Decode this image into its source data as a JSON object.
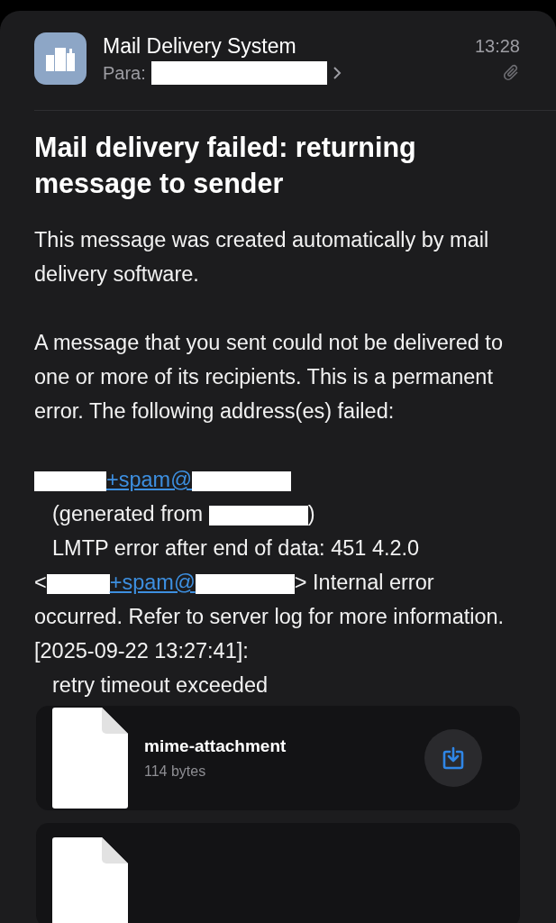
{
  "header": {
    "sender": "Mail Delivery System",
    "to_label": "Para:",
    "to_redacted": true,
    "time": "13:28",
    "has_attachment": true
  },
  "subject": "Mail delivery failed: returning message to sender",
  "paragraphs": [
    "This message was created automatically by mail delivery software.",
    "A message that you sent could not be delivered to one or more of its recipients. This is a permanent error. The following address(es) failed:"
  ],
  "error_lines": [
    {
      "indent": false,
      "parts": [
        {
          "kind": "redacted"
        },
        {
          "kind": "link",
          "text": "+spam@"
        },
        {
          "kind": "redacted"
        }
      ]
    },
    {
      "indent": true,
      "parts": [
        {
          "kind": "text",
          "text": "(generated from "
        },
        {
          "kind": "redacted"
        },
        {
          "kind": "text",
          "text": ")"
        }
      ]
    },
    {
      "indent": true,
      "parts": [
        {
          "kind": "text",
          "text": "LMTP error after end of data: 451 4.2.0"
        }
      ]
    },
    {
      "indent": false,
      "parts": [
        {
          "kind": "text",
          "text": "<"
        },
        {
          "kind": "redacted"
        },
        {
          "kind": "link",
          "text": "+spam@"
        },
        {
          "kind": "redacted"
        },
        {
          "kind": "text",
          "text": "> Internal error occurred. Refer to server log for more information. [2025-09-22 13:27:41]:"
        }
      ]
    },
    {
      "indent": true,
      "parts": [
        {
          "kind": "text",
          "text": "retry timeout exceeded"
        }
      ]
    }
  ],
  "attachments": [
    {
      "name": "mime-attachment",
      "size": "114 bytes"
    }
  ],
  "next_attachment_peek": true
}
